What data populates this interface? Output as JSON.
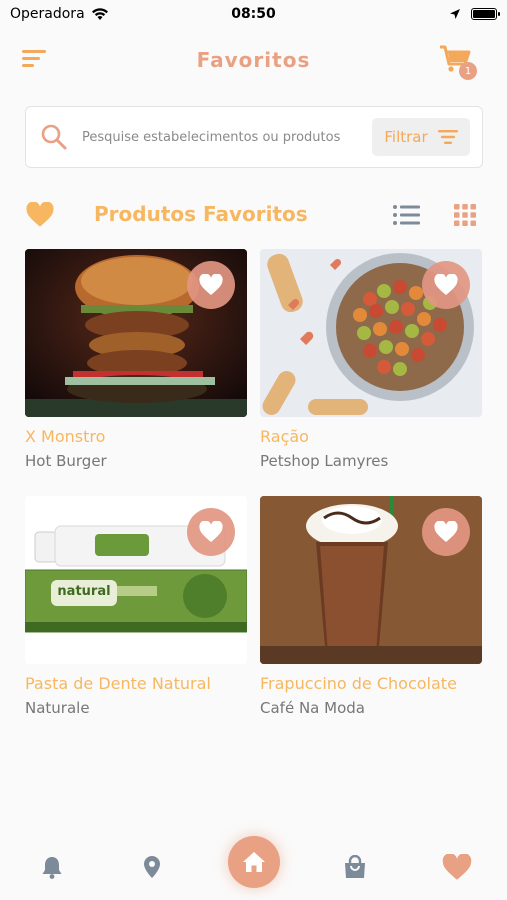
{
  "status_bar": {
    "carrier": "Operadora",
    "time": "08:50"
  },
  "header": {
    "title": "Favoritos",
    "cart_count": "1"
  },
  "search": {
    "placeholder": "Pesquise estabelecimentos ou produtos",
    "filter_label": "Filtrar"
  },
  "section": {
    "title": "Produtos Favoritos"
  },
  "products": [
    {
      "name": "X Monstro",
      "store": "Hot Burger",
      "image": "burger-photo"
    },
    {
      "name": "Ração",
      "store": "Petshop Lamyres",
      "image": "pet-food-photo"
    },
    {
      "name": "Pasta de Dente Natural",
      "store": "Naturale",
      "image": "toothpaste-photo"
    },
    {
      "name": "Frapuccino de Chocolate",
      "store": "Café Na Moda",
      "image": "frappuccino-photo"
    }
  ],
  "toothpaste_brand": "natural",
  "bottom_nav": [
    "bell-icon",
    "location-pin-icon",
    "home-icon",
    "shopping-bag-icon",
    "heart-icon"
  ],
  "colors": {
    "accent": "#e9a183",
    "primary_yellow": "#f7b760",
    "icon_grey": "#7d8a9a"
  }
}
